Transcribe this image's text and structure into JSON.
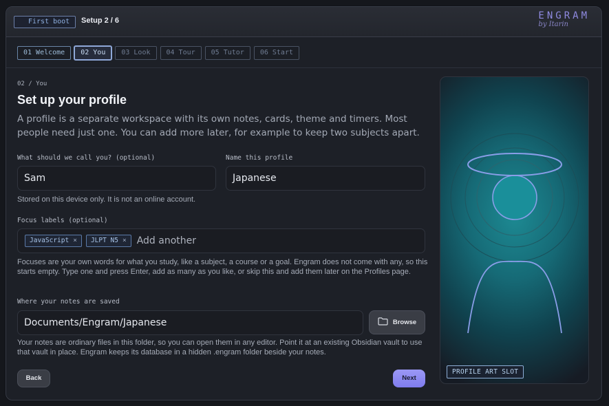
{
  "header": {
    "mode_label": "First boot",
    "setup_step": "Setup 2 / 6",
    "brand": "ENGRAM",
    "brand_by": "by Itarin"
  },
  "steps": [
    {
      "label": "01 Welcome",
      "state": "done"
    },
    {
      "label": "02 You",
      "state": "active"
    },
    {
      "label": "03 Look",
      "state": "upcoming"
    },
    {
      "label": "04 Tour",
      "state": "upcoming"
    },
    {
      "label": "05 Tutor",
      "state": "upcoming"
    },
    {
      "label": "06 Start",
      "state": "upcoming"
    }
  ],
  "main": {
    "crumb": "02 / You",
    "title": "Set up your profile",
    "intro": "A profile is a separate workspace with its own notes, cards, theme and timers. Most people need just one. You can add more later, for example to keep two subjects apart."
  },
  "form": {
    "name_label": "What should we call you? (optional)",
    "name_value": "Sam",
    "name_hint": "Stored on this device only. It is not an online account.",
    "profile_label": "Name this profile",
    "profile_value": "Japanese",
    "focus_label": "Focus labels (optional)",
    "focus_tags": [
      "JavaScript",
      "JLPT N5"
    ],
    "focus_placeholder": "Add another",
    "focus_hint": "Focuses are your own words for what you study, like a subject, a course or a goal. Engram does not come with any, so this starts empty. Type one and press Enter, add as many as you like, or skip this and add them later on the Profiles page.",
    "path_label": "Where your notes are saved",
    "path_value": "Documents/Engram/Japanese",
    "browse_label": "Browse",
    "path_hint": "Your notes are ordinary files in this folder, so you can open them in any editor. Point it at an existing Obsidian vault to use that vault in place. Engram keeps its database in a hidden .engram folder beside your notes."
  },
  "footer": {
    "back_label": "Back",
    "next_label": "Next"
  },
  "art": {
    "slot_label": "PROFILE ART SLOT"
  },
  "icons": {
    "browse": "folder-icon",
    "tag_remove": "close-icon"
  },
  "colors": {
    "accent": "#8f8ae0",
    "next_button": "#8f8cf2",
    "art_teal": "#1d8a93"
  }
}
